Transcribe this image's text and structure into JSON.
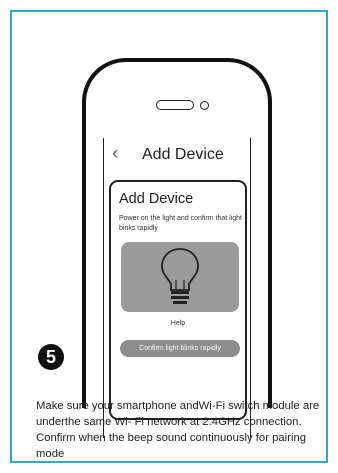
{
  "step": {
    "number": "5"
  },
  "phone": {
    "back_icon": "‹",
    "title": "Add Device",
    "card": {
      "title": "Add Device",
      "description": "Power on the light and confirm that light binks rapidly",
      "illustration_icon": "light-bulb-icon",
      "help_label": "Help",
      "confirm_label": "Confirm light blinks rapidly"
    }
  },
  "instructions": "Make sure your smartphone andWi-Fi switch module are underthe same Wi- Fi network at 2.4GHz connection. Confirm when  the beep sound continuously for pairing mode",
  "colors": {
    "border": "#2ba9c9",
    "button": "#8e8e8e",
    "illustration_bg": "#9b9b9b"
  }
}
